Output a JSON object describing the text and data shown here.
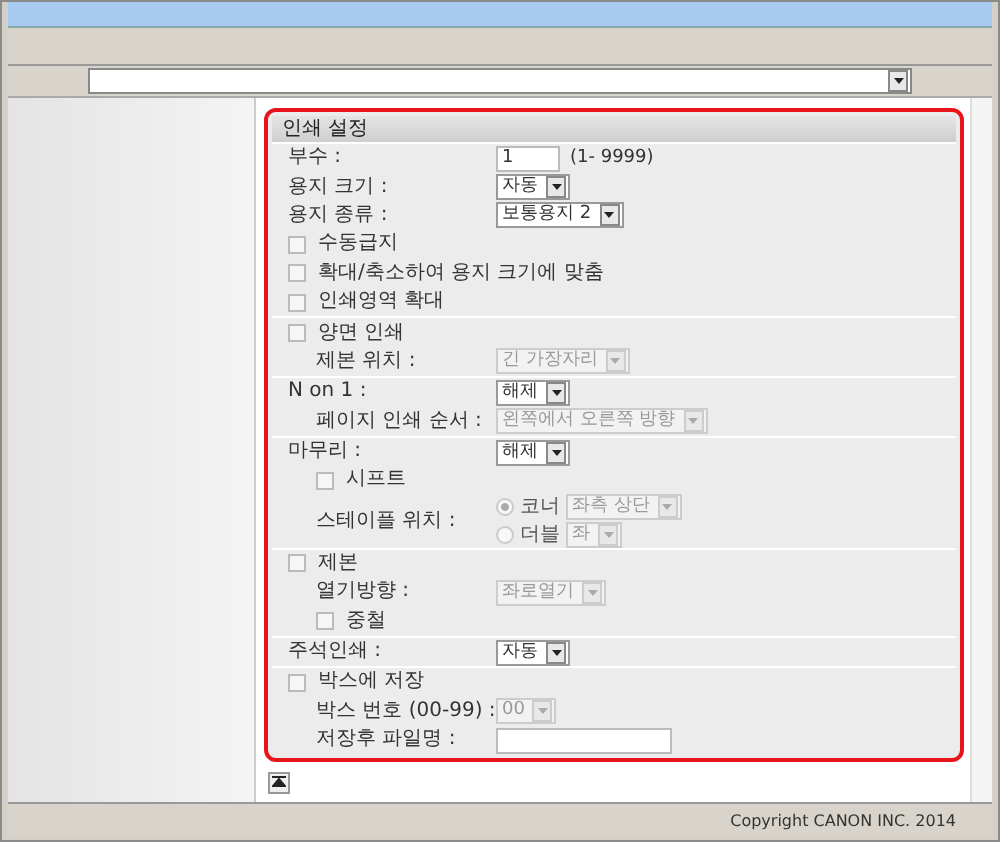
{
  "panel": {
    "title": "인쇄 설정",
    "sections": [
      {
        "rows": [
          {
            "kind": "input",
            "label": "부수 :",
            "value": "1",
            "note": "(1- 9999)"
          },
          {
            "kind": "select",
            "label": "용지 크기 :",
            "value": "자동",
            "disabled": false
          },
          {
            "kind": "select",
            "label": "용지 종류 :",
            "value": "보통용지 2",
            "disabled": false
          },
          {
            "kind": "checkbox",
            "label": "수동급지",
            "checked": false
          },
          {
            "kind": "checkbox",
            "label": "확대/축소하여 용지 크기에 맞춤",
            "checked": false
          },
          {
            "kind": "checkbox",
            "label": "인쇄영역 확대",
            "checked": false
          }
        ]
      },
      {
        "rows": [
          {
            "kind": "checkbox",
            "label": "양면 인쇄",
            "checked": false,
            "children": [
              {
                "kind": "select",
                "label": "제본 위치 :",
                "value": "긴 가장자리",
                "disabled": true
              }
            ]
          }
        ]
      },
      {
        "rows": [
          {
            "kind": "select",
            "label": "N on 1 :",
            "value": "해제",
            "disabled": false,
            "children": [
              {
                "kind": "select",
                "label": "페이지 인쇄 순서 :",
                "value": "왼쪽에서 오른쪽 방향",
                "disabled": true
              }
            ]
          }
        ]
      },
      {
        "rows": [
          {
            "kind": "select",
            "label": "마무리 :",
            "value": "해제",
            "disabled": false,
            "children": [
              {
                "kind": "checkbox",
                "label": "시프트",
                "checked": false
              },
              {
                "kind": "radio",
                "label": "스테이플 위치 :",
                "options": [
                  {
                    "label": "코너",
                    "selected": true,
                    "value": "좌측 상단"
                  },
                  {
                    "label": "더블",
                    "selected": false,
                    "value": "좌"
                  }
                ]
              }
            ]
          }
        ]
      },
      {
        "rows": [
          {
            "kind": "checkbox",
            "label": "제본",
            "checked": false,
            "children": [
              {
                "kind": "select",
                "label": "열기방향 :",
                "value": "좌로열기",
                "disabled": true
              },
              {
                "kind": "checkbox",
                "label": "중철",
                "checked": false
              }
            ]
          }
        ]
      },
      {
        "rows": [
          {
            "kind": "select",
            "label": "주석인쇄 :",
            "value": "자동",
            "disabled": false
          }
        ]
      },
      {
        "rows": [
          {
            "kind": "checkbox",
            "label": "박스에 저장",
            "checked": false,
            "children": [
              {
                "kind": "select",
                "label": "박스 번호 (00-99) :",
                "value": "00",
                "disabled": true
              },
              {
                "kind": "input",
                "label": "저장후 파일명 :"
              }
            ]
          }
        ]
      }
    ]
  },
  "footer": {
    "copyright": "Copyright CANON INC. 2014"
  }
}
